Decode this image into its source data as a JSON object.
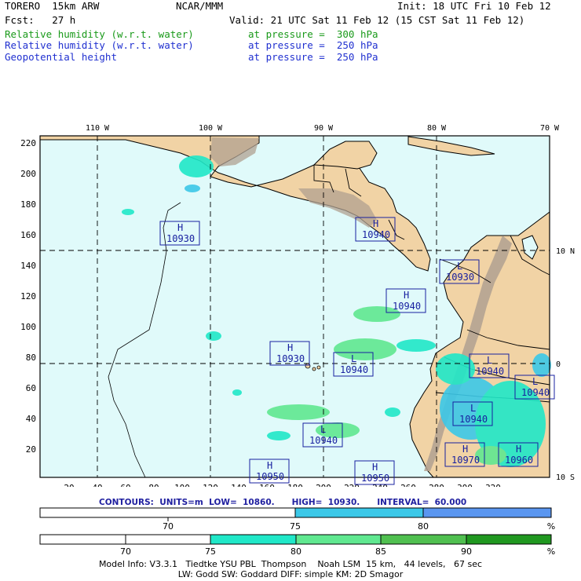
{
  "header": {
    "model": "TORERO  15km ARW",
    "center": "NCAR/MMM",
    "init": "Init: 18 UTC Fri 10 Feb 12",
    "fcst": "Fcst:   27 h",
    "valid": "Valid: 21 UTC Sat 11 Feb 12 (15 CST Sat 11 Feb 12)",
    "fields": [
      {
        "name": "Relative humidity (w.r.t. water)",
        "level": "at pressure =  300 hPa",
        "color": "#1a9a1a"
      },
      {
        "name": "Relative humidity (w.r.t. water)",
        "level": "at pressure =  250 hPa",
        "color": "#2030d0"
      },
      {
        "name": "Geopotential height",
        "level": "at pressure =  250 hPa",
        "color": "#2030d0"
      }
    ]
  },
  "map": {
    "lon_labels": [
      "110 W",
      "100 W",
      "90 W",
      "80 W",
      "70 W"
    ],
    "lat_labels": [
      "10 N",
      "0",
      "10 S"
    ],
    "x_ticks": [
      "20",
      "40",
      "60",
      "80",
      "100",
      "120",
      "140",
      "160",
      "180",
      "200",
      "220",
      "240",
      "260",
      "280",
      "300",
      "320"
    ],
    "y_ticks": [
      "20",
      "40",
      "60",
      "80",
      "100",
      "120",
      "140",
      "160",
      "180",
      "200",
      "220"
    ],
    "ocean_color": "#e0fafa",
    "land_color": "#f1d3a5",
    "terrain_color": "#b0a090",
    "centers": [
      {
        "type": "H",
        "value": "10930"
      },
      {
        "type": "H",
        "value": "10940"
      },
      {
        "type": "L",
        "value": "10930"
      },
      {
        "type": "H",
        "value": "10940"
      },
      {
        "type": "H",
        "value": "10930"
      },
      {
        "type": "L",
        "value": "10940"
      },
      {
        "type": "L",
        "value": "10940"
      },
      {
        "type": "L",
        "value": "10940"
      },
      {
        "type": "L",
        "value": "10940"
      },
      {
        "type": "L",
        "value": "10940"
      },
      {
        "type": "H",
        "value": "10970"
      },
      {
        "type": "H",
        "value": "10960"
      },
      {
        "type": "H",
        "value": "10950"
      },
      {
        "type": "H",
        "value": "10950"
      }
    ]
  },
  "contours": {
    "text": "CONTOURS:  UNITS=m  LOW=  10860.      HIGH=  10930.      INTERVAL=  60.000"
  },
  "colorbar_250": {
    "labels": [
      "70",
      "75",
      "80",
      "%"
    ],
    "colors": [
      "#ffffff",
      "#3cc8e8",
      "#5a96f0"
    ]
  },
  "colorbar_300": {
    "labels": [
      "70",
      "75",
      "80",
      "85",
      "90",
      "%"
    ],
    "colors": [
      "#ffffff",
      "#ffffff",
      "#20e8c8",
      "#60e890",
      "#50c050",
      "#209820"
    ]
  },
  "footer": {
    "line1": "Model Info: V3.3.1   Tiedtke YSU PBL  Thompson    Noah LSM  15 km,   44 levels,   67 sec",
    "line2": "LW: Godd SW: Goddard DIFF: simple KM: 2D Smagor"
  }
}
